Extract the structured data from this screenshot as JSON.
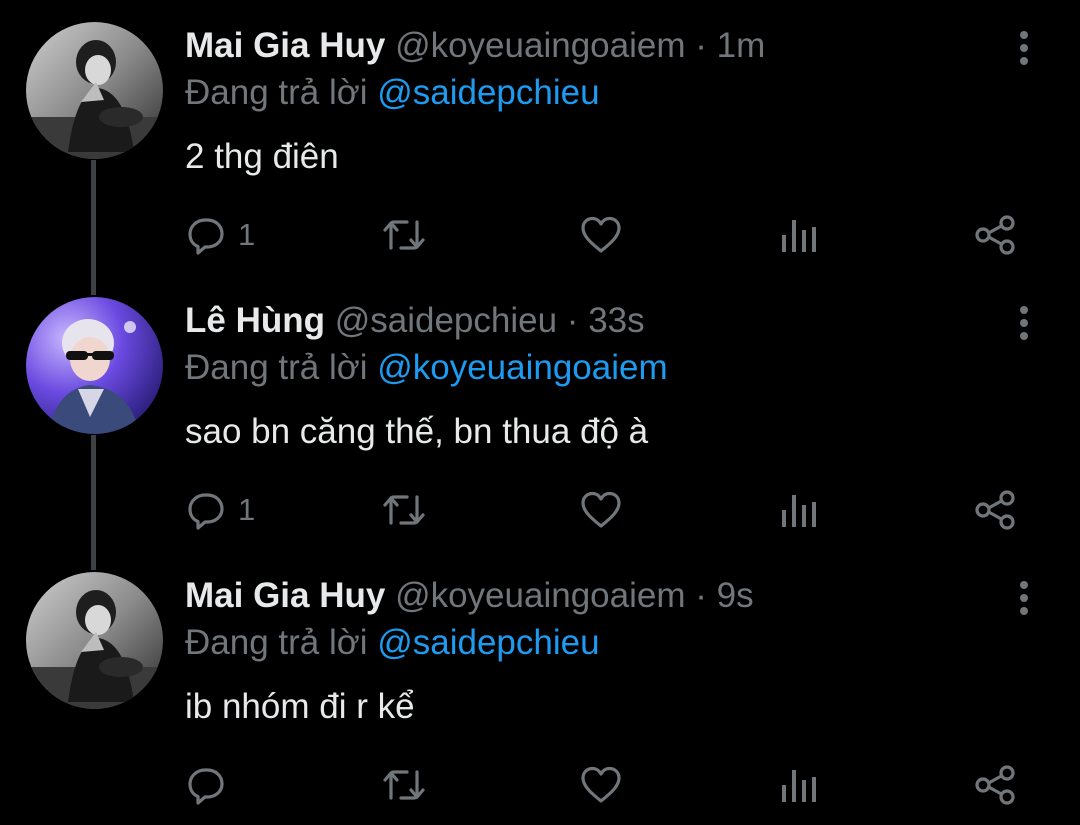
{
  "colors": {
    "background": "#000000",
    "primary_text": "#e7e9ea",
    "secondary_text": "#71767b",
    "accent": "#1d9bf0",
    "thread_line": "#3e4144"
  },
  "tweets": [
    {
      "name": "Mai Gia Huy",
      "handle": "@koyeuaingoaiem",
      "separator": "·",
      "time": "1m",
      "reply_prefix": "Đang trả lời",
      "reply_to": "@saidepchieu",
      "text": "2 thg điên",
      "reply_count": "1",
      "avatar": "avatar-bw-portrait",
      "icons": [
        "more-vertical-icon",
        "reply-icon",
        "retweet-icon",
        "like-icon",
        "views-icon",
        "share-icon"
      ]
    },
    {
      "name": "Lê Hùng",
      "handle": "@saidepchieu",
      "separator": "·",
      "time": "33s",
      "reply_prefix": "Đang trả lời",
      "reply_to": "@koyeuaingoaiem",
      "text": "sao bn căng thế, bn thua độ à",
      "reply_count": "1",
      "avatar": "avatar-purple-sunglasses",
      "icons": [
        "more-vertical-icon",
        "reply-icon",
        "retweet-icon",
        "like-icon",
        "views-icon",
        "share-icon"
      ]
    },
    {
      "name": "Mai Gia Huy",
      "handle": "@koyeuaingoaiem",
      "separator": "·",
      "time": "9s",
      "reply_prefix": "Đang trả lời",
      "reply_to": "@saidepchieu",
      "text": "ib nhóm đi r kể",
      "reply_count": "",
      "avatar": "avatar-bw-portrait",
      "icons": [
        "more-vertical-icon",
        "reply-icon",
        "retweet-icon",
        "like-icon",
        "views-icon",
        "share-icon"
      ]
    }
  ]
}
